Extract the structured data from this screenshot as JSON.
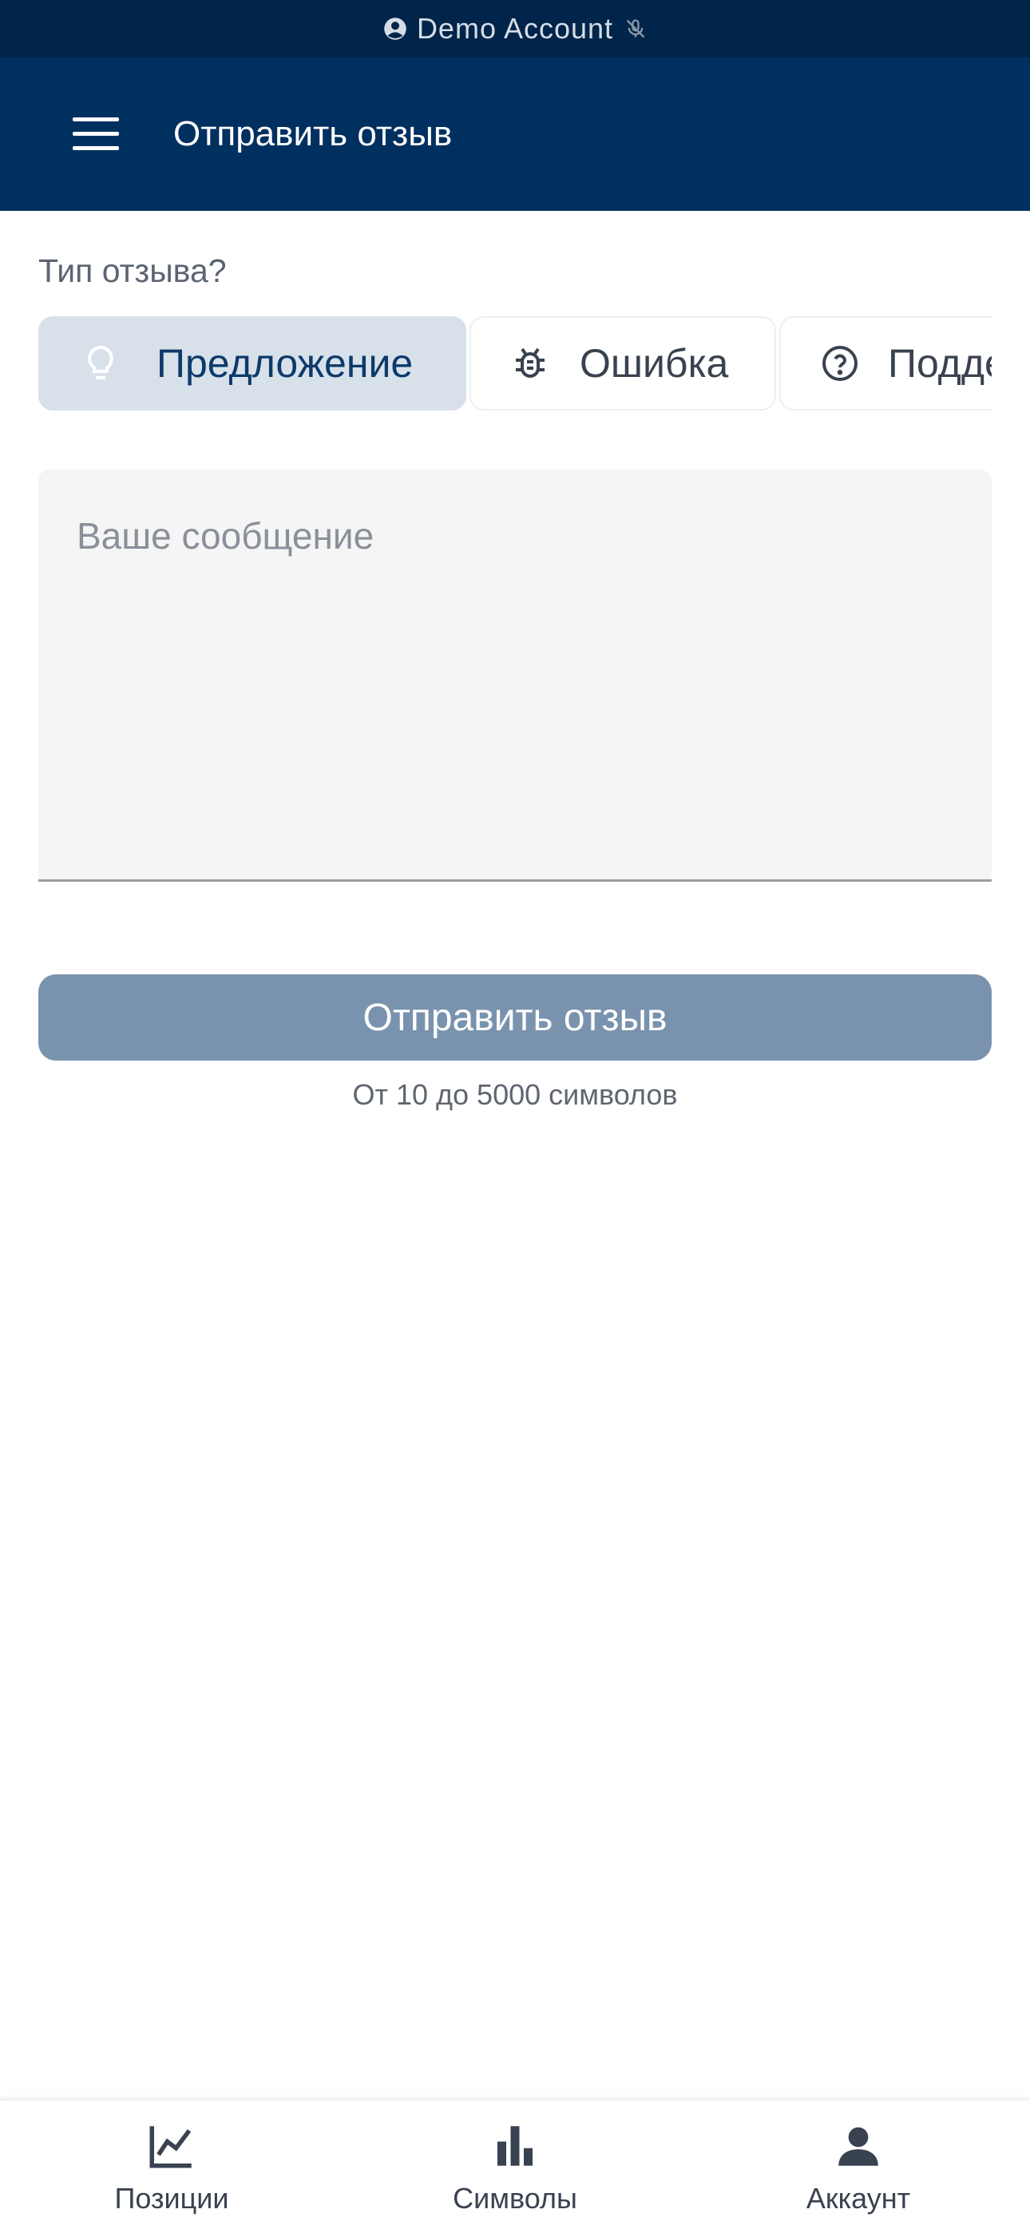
{
  "status_bar": {
    "account_label": "Demo Account",
    "account_icon": "account-circle-icon",
    "status_icon": "mic-off-icon"
  },
  "app_bar": {
    "menu_icon": "hamburger-menu-icon",
    "title": "Отправить отзыв"
  },
  "feedback_type": {
    "label": "Тип отзыва?",
    "options": [
      {
        "label": "Предложение",
        "icon": "lightbulb-icon",
        "selected": true
      },
      {
        "label": "Ошибка",
        "icon": "bug-icon",
        "selected": false
      },
      {
        "label": "Подде",
        "icon": "help-circle-icon",
        "selected": false
      }
    ]
  },
  "message": {
    "placeholder": "Ваше сообщение",
    "value": ""
  },
  "submit": {
    "label": "Отправить отзыв",
    "hint": "От 10 до 5000 символов"
  },
  "bottom_nav": {
    "items": [
      {
        "label": "Позиции",
        "icon": "line-chart-icon"
      },
      {
        "label": "Символы",
        "icon": "bar-chart-icon"
      },
      {
        "label": "Аккаунт",
        "icon": "person-icon"
      }
    ]
  },
  "colors": {
    "app_bar": "#00305f",
    "status_bar": "#00244a",
    "selected_chip": "#d8e1ea",
    "submit_button": "#7993ae"
  }
}
